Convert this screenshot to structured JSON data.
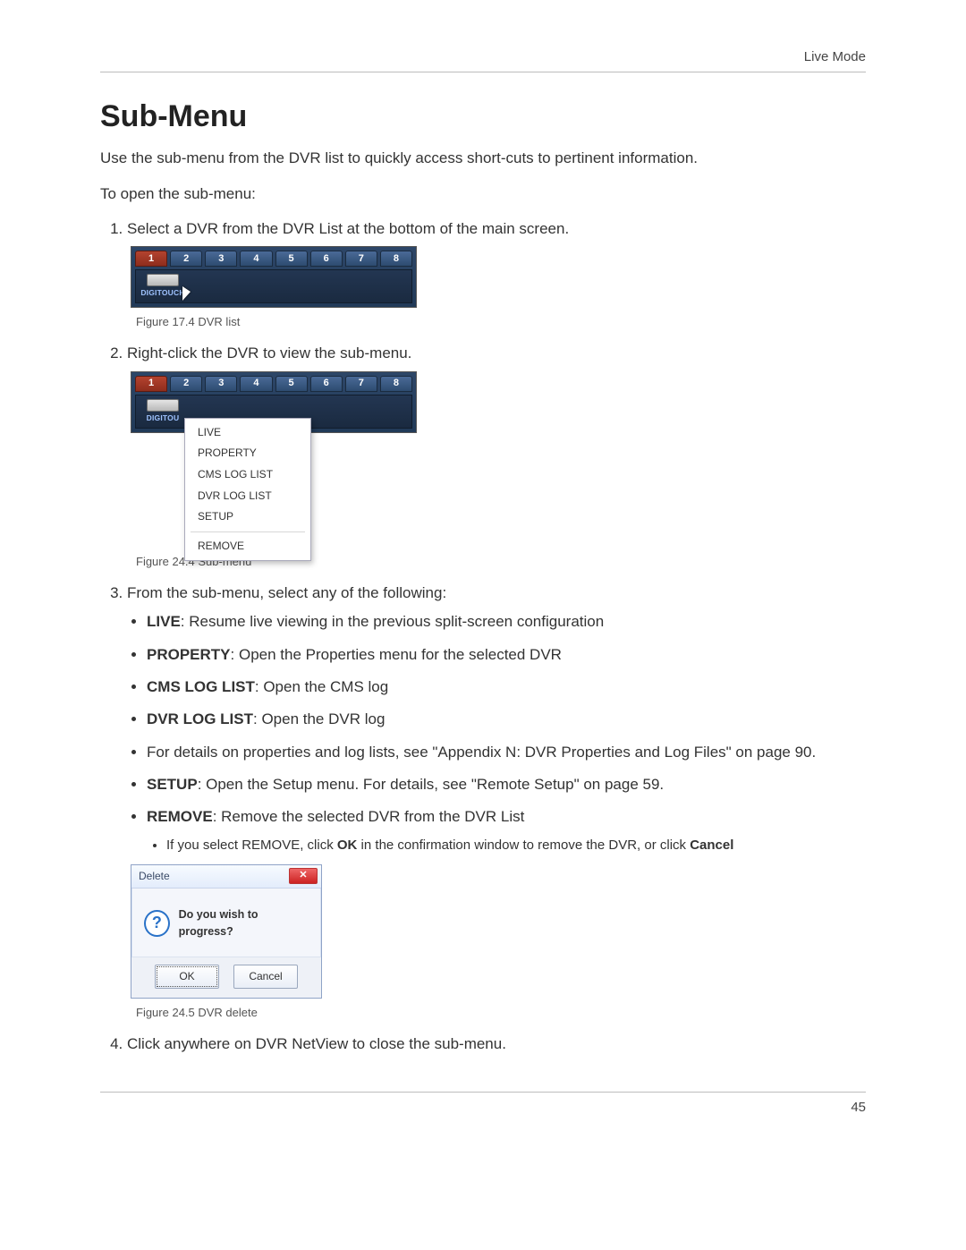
{
  "header": {
    "right_label": "Live Mode"
  },
  "title": "Sub-Menu",
  "intro": "Use the sub-menu from the DVR list to quickly access short-cuts to pertinent information.",
  "open_line": "To open the sub-menu:",
  "steps": {
    "s1": "Select a DVR from the DVR List at the bottom of the main screen.",
    "s2": "Right-click the DVR to view the sub-menu.",
    "s3_lead": "From the sub-menu, select any of the following:",
    "s4": "Click anywhere on DVR NetView to close the sub-menu."
  },
  "dvr_bar": {
    "tabs": [
      "1",
      "2",
      "3",
      "4",
      "5",
      "6",
      "7",
      "8"
    ],
    "selected_index": 0,
    "device_label_1": "DIGITOUCH",
    "device_label_2": "DIGITOU"
  },
  "context_menu": {
    "items_top": [
      "LIVE",
      "PROPERTY",
      "CMS LOG LIST",
      "DVR LOG LIST",
      "SETUP"
    ],
    "items_bottom": [
      "REMOVE"
    ]
  },
  "fig1_caption": "Figure 17.4 DVR list",
  "fig2_caption": "Figure 24.4 Sub-menu",
  "fig3_caption": "Figure 24.5 DVR delete",
  "options": {
    "live_b": "LIVE",
    "live_t": ": Resume live viewing in the previous split-screen configuration",
    "prop_b": "PROPERTY",
    "prop_t": ": Open the Properties menu for the selected DVR",
    "cms_b": "CMS LOG LIST",
    "cms_t": ": Open the CMS log",
    "dvr_b": "DVR LOG LIST",
    "dvr_t": ": Open the DVR log",
    "details_t": "For details on properties and log lists, see \"Appendix N: DVR Properties and Log Files\" on page 90.",
    "setup_b": "SETUP",
    "setup_t": ": Open the Setup menu. For details, see \"Remote Setup\" on page 59.",
    "remove_b": "REMOVE",
    "remove_t": ": Remove the selected DVR from the DVR List",
    "remove_note_pre": "If you select REMOVE, click ",
    "remove_note_ok": "OK",
    "remove_note_mid": " in the confirmation window to remove the DVR, or click ",
    "remove_note_cancel": "Cancel"
  },
  "dialog": {
    "title": "Delete",
    "close_glyph": "✕",
    "question_glyph": "?",
    "message": "Do you wish to progress?",
    "ok": "OK",
    "cancel": "Cancel"
  },
  "page_number": "45"
}
